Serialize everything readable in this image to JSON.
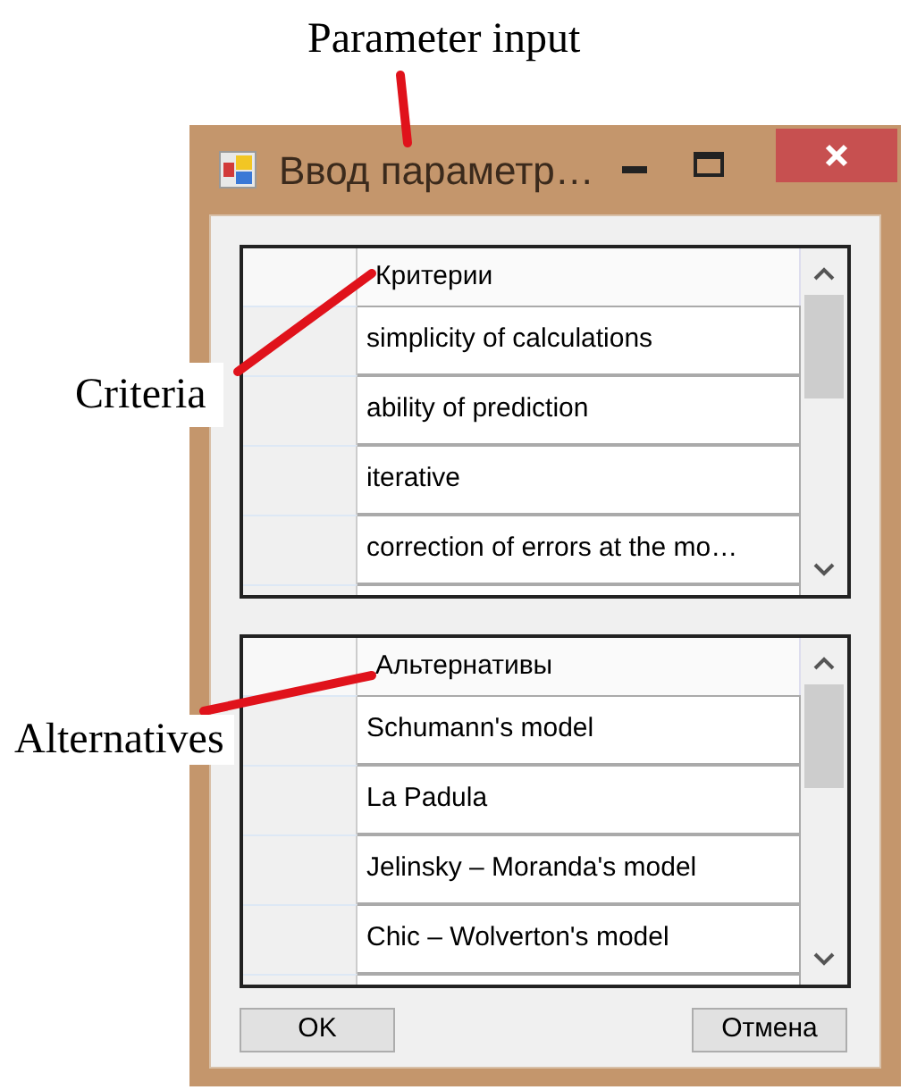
{
  "annotations": [
    {
      "text": "Parameter input"
    },
    {
      "text": "Criteria"
    },
    {
      "text": "Alternatives"
    }
  ],
  "window": {
    "title": "Ввод параметр…"
  },
  "grids": [
    {
      "header": "Критерии",
      "rows": [
        "simplicity of calculations",
        "ability of prediction",
        "iterative",
        "correction of errors at the mo…"
      ]
    },
    {
      "header": "Альтернативы",
      "rows": [
        "Schumann's model",
        "La Padula",
        "Jelinsky – Moranda's model",
        "Chic – Wolverton's model"
      ]
    }
  ],
  "buttons": [
    "OK",
    "Отмена"
  ]
}
